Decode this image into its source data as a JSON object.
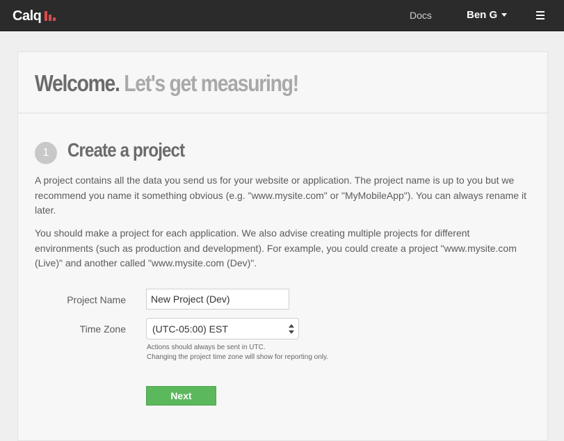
{
  "topbar": {
    "logo_text": "Calq",
    "docs_label": "Docs",
    "user_label": "Ben G"
  },
  "colors": {
    "topbar_bg": "#2b2b2b",
    "logo_accent": "#d84b4b",
    "next_button": "#5cb85c"
  },
  "welcome": {
    "title_strong": "Welcome.",
    "title_light": "Let's get measuring!"
  },
  "step": {
    "number": "1",
    "title": "Create a project",
    "paragraph_1": "A project contains all the data you send us for your website or application. The project name is up to you but we recommend you name it something obvious (e.g. \"www.mysite.com\" or \"MyMobileApp\"). You can always rename it later.",
    "paragraph_2": "You should make a project for each application. We also advise creating multiple projects for different environments (such as production and development). For example, you could create a project \"www.mysite.com (Live)\" and another called \"www.mysite.com (Dev)\"."
  },
  "form": {
    "project_name_label": "Project Name",
    "project_name_value": "New Project (Dev)",
    "time_zone_label": "Time Zone",
    "time_zone_value": "(UTC-05:00) EST",
    "help_line_1": "Actions should always be sent in UTC.",
    "help_line_2": "Changing the project time zone will show for reporting only.",
    "next_label": "Next"
  },
  "icons": {
    "logo": "bar-chart-icon",
    "user_menu": "caret-down-icon",
    "main_menu": "hamburger-menu-icon",
    "select": "select-arrows-icon"
  }
}
